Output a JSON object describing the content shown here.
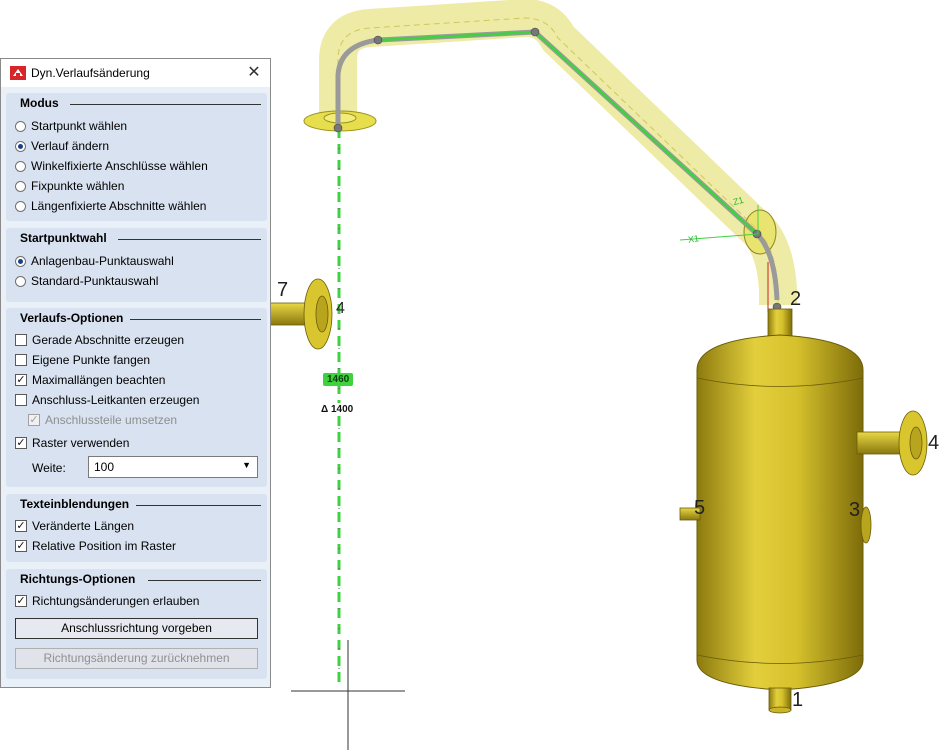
{
  "dialog": {
    "title": "Dyn.Verlaufsänderung",
    "close_glyph": "✕",
    "icon": "hicad-app-icon"
  },
  "modus": {
    "title": "Modus",
    "options": [
      {
        "label": "Startpunkt wählen",
        "checked": false
      },
      {
        "label": "Verlauf ändern",
        "checked": true
      },
      {
        "label": "Winkelfixierte Anschlüsse wählen",
        "checked": false
      },
      {
        "label": "Fixpunkte wählen",
        "checked": false
      },
      {
        "label": "Längenfixierte Abschnitte wählen",
        "checked": false
      }
    ]
  },
  "startpunktwahl": {
    "title": "Startpunktwahl",
    "options": [
      {
        "label": "Anlagenbau-Punktauswahl",
        "checked": true
      },
      {
        "label": "Standard-Punktauswahl",
        "checked": false
      }
    ]
  },
  "verlaufs_optionen": {
    "title": "Verlaufs-Optionen",
    "checks": [
      {
        "label": "Gerade Abschnitte erzeugen",
        "checked": false
      },
      {
        "label": "Eigene Punkte fangen",
        "checked": false
      },
      {
        "label": "Maximallängen beachten",
        "checked": true
      },
      {
        "label": "Anschluss-Leitkanten erzeugen",
        "checked": false
      },
      {
        "label": "Anschlussteile umsetzen",
        "checked": true,
        "disabled": true
      },
      {
        "label": "Raster verwenden",
        "checked": true
      }
    ],
    "weite_label": "Weite:",
    "weite_value": "100"
  },
  "texteinblendungen": {
    "title": "Texteinblendungen",
    "checks": [
      {
        "label": "Veränderte Längen",
        "checked": true
      },
      {
        "label": "Relative Position im Raster",
        "checked": true
      }
    ]
  },
  "richtungs_optionen": {
    "title": "Richtungs-Optionen",
    "checks": [
      {
        "label": "Richtungsänderungen erlauben",
        "checked": true
      }
    ],
    "button_primary": "Anschlussrichtung vorgeben",
    "button_secondary": "Richtungsänderung zurücknehmen"
  },
  "viewport": {
    "dim_length": "1460",
    "dim_delta": "Δ 1400",
    "labels": {
      "n1": "1",
      "n2": "2",
      "n3": "3",
      "n4": "4",
      "n5": "5",
      "n7": "7",
      "x1": "X1",
      "z1": "Z1"
    },
    "colors": {
      "pipe_yellow": "#e6e04a",
      "vessel_gold": "#d8c22e",
      "path_green": "#3ed33e",
      "dialog_bg": "#eaf0f8",
      "group_bg": "#d9e2f0"
    }
  }
}
